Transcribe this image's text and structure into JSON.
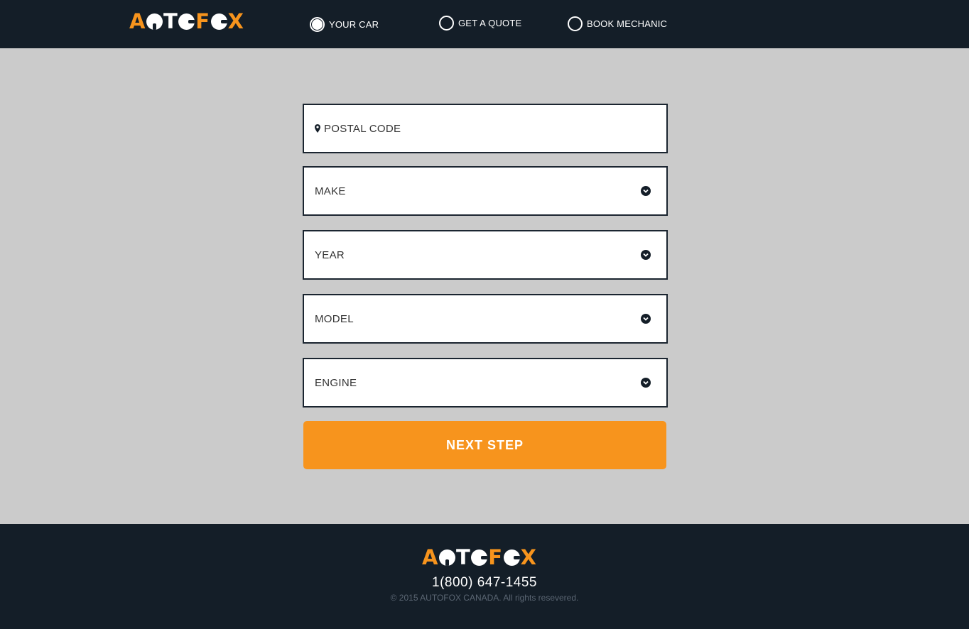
{
  "brand": {
    "logo_text": "AUTOFOX",
    "colors": {
      "orange": "#f7941d",
      "dark": "#141e28",
      "background": "#cbcbcb"
    }
  },
  "nav": {
    "steps": [
      {
        "label": "YOUR CAR",
        "active": true
      },
      {
        "label": "GET A QUOTE",
        "active": false
      },
      {
        "label": "BOOK MECHANIC",
        "active": false
      }
    ]
  },
  "form": {
    "postal_code": {
      "placeholder": "POSTAL CODE",
      "value": "",
      "icon": "map-marker-icon"
    },
    "make": {
      "selected": "MAKE",
      "icon": "chevron-down-circle-icon"
    },
    "year": {
      "selected": "YEAR",
      "icon": "chevron-down-circle-icon"
    },
    "model": {
      "selected": "MODEL",
      "icon": "chevron-down-circle-icon"
    },
    "engine": {
      "selected": "ENGINE",
      "icon": "chevron-down-circle-icon"
    },
    "submit_label": "NEXT STEP"
  },
  "footer": {
    "phone": "1(800) 647-1455",
    "copyright": "© 2015 AUTOFOX CANADA. All rights resevered."
  }
}
